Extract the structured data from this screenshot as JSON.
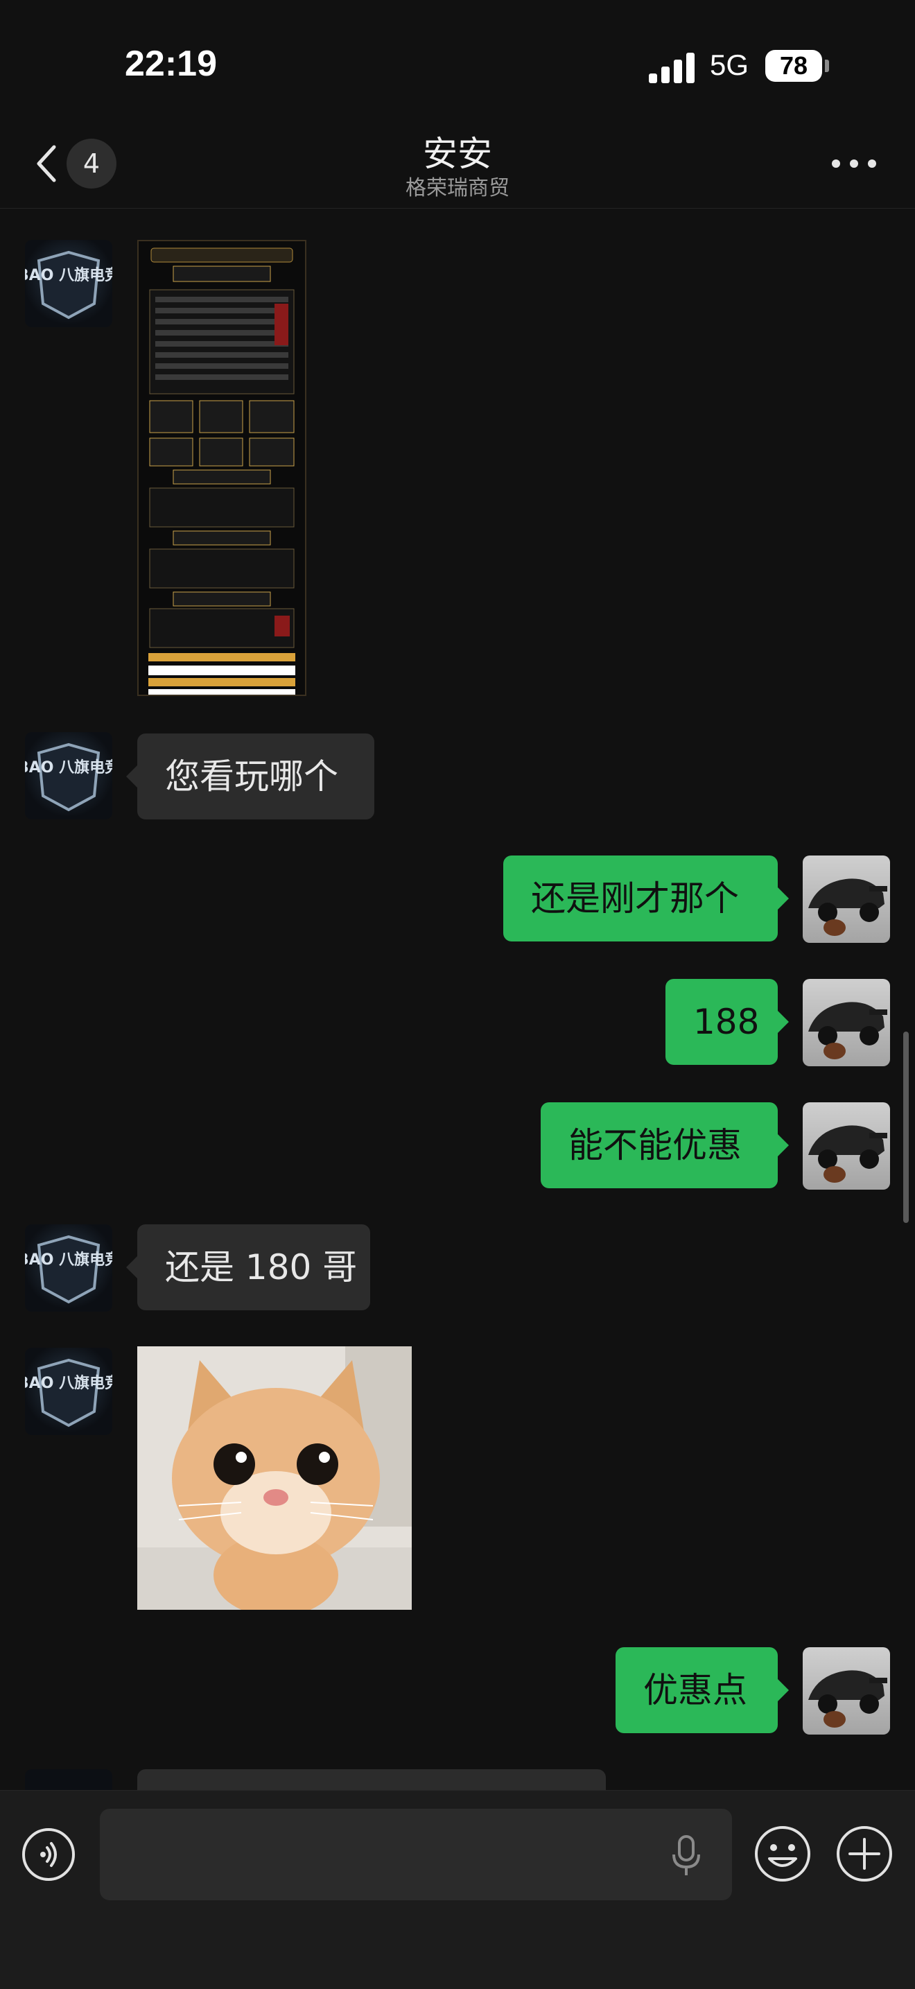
{
  "status_bar": {
    "time": "22:19",
    "network": "5G",
    "battery": "78"
  },
  "header": {
    "back_count": "4",
    "title": "安安",
    "subtitle": "格荣瑞商贸"
  },
  "messages": [
    {
      "side": "left",
      "type": "image",
      "image": "price-list-poster"
    },
    {
      "side": "left",
      "type": "text",
      "text": "您看玩哪个"
    },
    {
      "side": "right",
      "type": "text",
      "text": "还是刚才那个"
    },
    {
      "side": "right",
      "type": "text",
      "text": "188"
    },
    {
      "side": "right",
      "type": "text",
      "text": "能不能优惠"
    },
    {
      "side": "left",
      "type": "text",
      "text": "还是 180 哥"
    },
    {
      "side": "left",
      "type": "image",
      "image": "kitten-sticker"
    },
    {
      "side": "right",
      "type": "text",
      "text": "优惠点"
    }
  ],
  "contact_avatar": {
    "text": "BAO 八旗电竞"
  },
  "input": {
    "placeholder": "",
    "value": ""
  },
  "colors": {
    "background": "#111111",
    "incoming_bubble": "#2c2c2c",
    "outgoing_bubble": "#2bb858"
  },
  "icons": [
    "back-chevron-icon",
    "more-icon",
    "voice-icon",
    "microphone-icon",
    "emoji-icon",
    "plus-icon"
  ]
}
